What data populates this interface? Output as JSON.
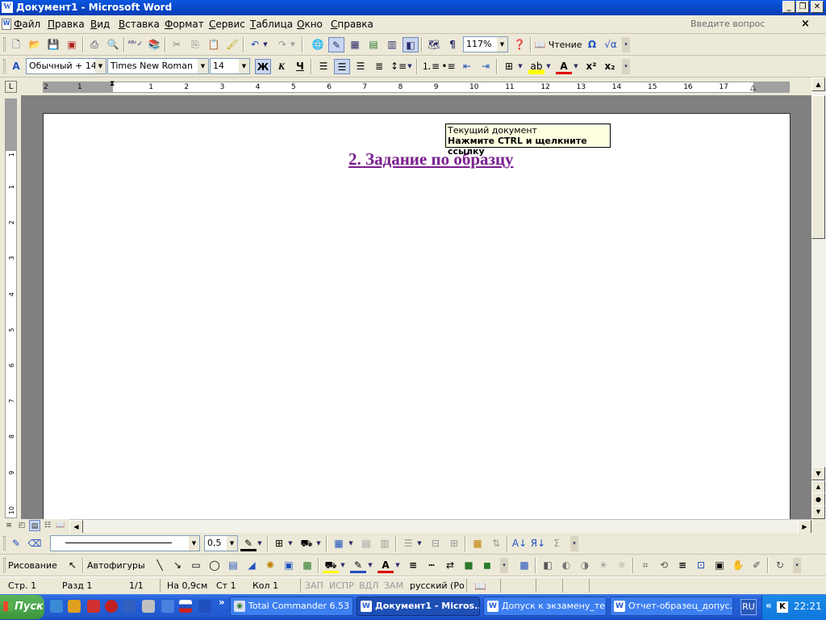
{
  "window": {
    "title": "Документ1 - Microsoft Word",
    "controls": [
      "_",
      "▫",
      "×"
    ]
  },
  "menu": {
    "items": [
      {
        "label": "Файл",
        "u": "Ф",
        "rest": "айл"
      },
      {
        "label": "Правка",
        "u": "П",
        "rest": "равка"
      },
      {
        "label": "Вид",
        "u": "В",
        "rest": "ид"
      },
      {
        "label": "Вставка",
        "u": "В",
        "rest": "ставка"
      },
      {
        "label": "Формат",
        "u": "Ф",
        "rest": "ормат"
      },
      {
        "label": "Сервис",
        "u": "С",
        "rest": "ервис"
      },
      {
        "label": "Таблица",
        "u": "Т",
        "rest": "аблица"
      },
      {
        "label": "Окно",
        "u": "О",
        "rest": "кно"
      },
      {
        "label": "Справка",
        "u": "С",
        "rest": "правка"
      }
    ],
    "help_placeholder": "Введите вопрос"
  },
  "standard_toolbar": {
    "zoom": "117%",
    "reading": "Чтение"
  },
  "formatting_toolbar": {
    "style": "Обычный + 14 г",
    "font": "Times New Roman",
    "size": "14",
    "bold": "Ж",
    "italic": "К",
    "underline": "Ч"
  },
  "ruler": {
    "h_labels": [
      "2",
      "1",
      "1",
      "2",
      "3",
      "4",
      "5",
      "6",
      "7",
      "8",
      "9",
      "10",
      "11",
      "12",
      "13",
      "14",
      "15",
      "16",
      "17"
    ],
    "v_labels": [
      "1",
      "1",
      "2",
      "3",
      "4",
      "5",
      "6",
      "7",
      "8",
      "9",
      "10"
    ]
  },
  "document": {
    "heading": "2. Задание по образцу",
    "tooltip_line1": "Текущий документ",
    "tooltip_line2": "Нажмите CTRL и щелкните ссылку"
  },
  "tables_toolbar": {
    "line_width": "0,5"
  },
  "drawing_toolbar": {
    "drawing": "Рисование",
    "autoshapes": "Автофигуры"
  },
  "status": {
    "page": "Стр. 1",
    "section": "Разд 1",
    "pages": "1/1",
    "at": "На 0,9см",
    "line": "Ст 1",
    "col": "Кол 1",
    "rec": "ЗАП",
    "trk": "ИСПР",
    "ext": "ВДЛ",
    "ovr": "ЗАМ",
    "lang": "русский (Ро"
  },
  "taskbar": {
    "start": "Пуск",
    "tasks": [
      {
        "label": "Total Commander 6.53 ...",
        "active": false
      },
      {
        "label": "Документ1 - Micros...",
        "active": true
      },
      {
        "label": "Допуск к экзамену_те...",
        "active": false
      },
      {
        "label": "Отчет-образец_допус...",
        "active": false
      }
    ],
    "lang": "RU",
    "clock": "22:21"
  }
}
